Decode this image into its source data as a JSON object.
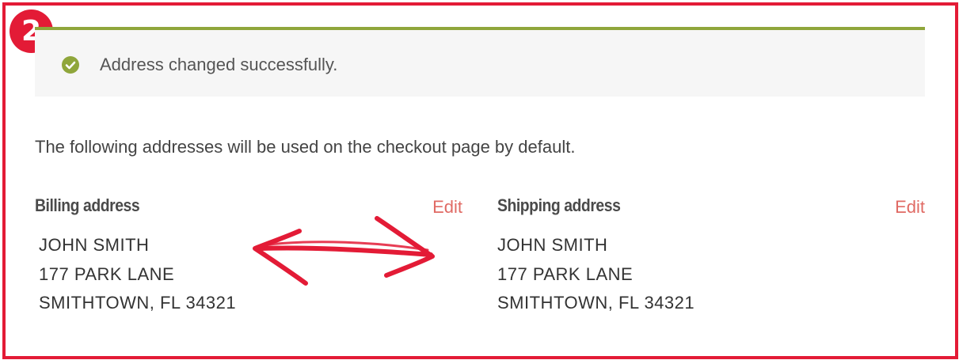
{
  "step_badge": "2",
  "notice": {
    "icon": "check-circle-icon",
    "message": "Address changed successfully."
  },
  "intro_text": "The following addresses will be used on the checkout page by default.",
  "billing": {
    "title": "Billing address",
    "edit_label": "Edit",
    "lines": [
      "JOHN SMITH",
      "177 PARK LANE",
      "SMITHTOWN, FL 34321"
    ]
  },
  "shipping": {
    "title": "Shipping address",
    "edit_label": "Edit",
    "lines": [
      "JOHN SMITH",
      "177 PARK LANE",
      "SMITHTOWN, FL 34321"
    ]
  },
  "colors": {
    "annotation_red": "#e31b36",
    "success_green": "#8fa63b",
    "link": "#e06a64"
  }
}
